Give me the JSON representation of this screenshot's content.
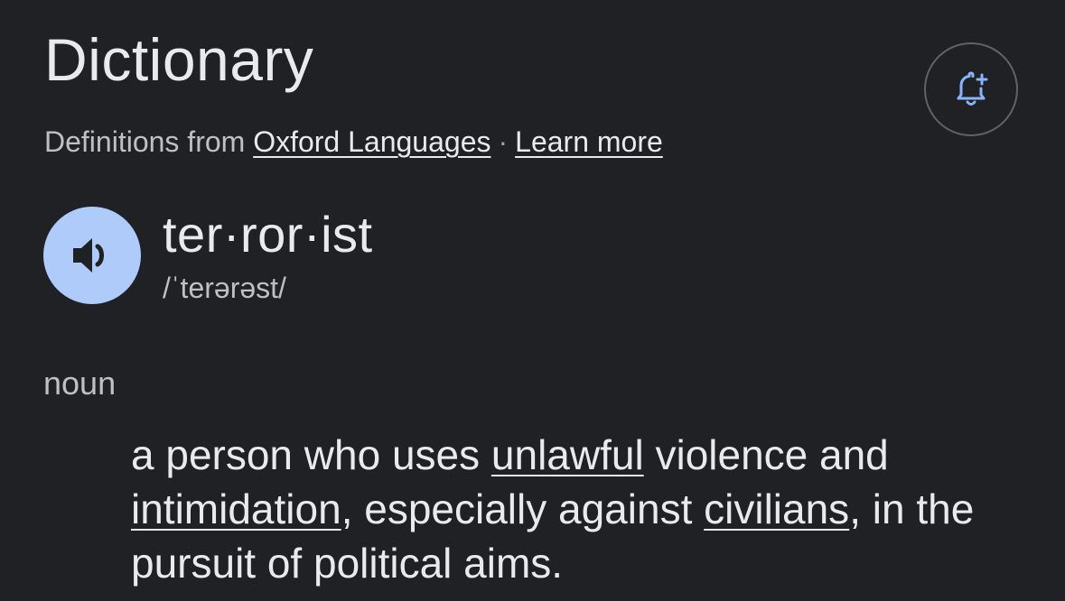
{
  "header": {
    "title": "Dictionary",
    "alert_icon": "bell-plus-icon"
  },
  "source": {
    "prefix": "Definitions from",
    "provider_link": "Oxford Languages",
    "separator": "·",
    "learn_more_link": "Learn more"
  },
  "entry": {
    "speaker_icon": "speaker-icon",
    "headword": "ter·ror·ist",
    "phonetic": "/ˈterərəst/",
    "part_of_speech": "noun",
    "definition": {
      "t1": "a person who uses ",
      "l1": "unlawful",
      "t2": " violence and ",
      "l2": "intimidation",
      "t3": ", especially against ",
      "l3": "civilians",
      "t4": ", in the pursuit of political aims."
    }
  },
  "colors": {
    "background": "#202124",
    "speaker_button": "#aecbfa",
    "icon_accent": "#8ab4f8"
  }
}
